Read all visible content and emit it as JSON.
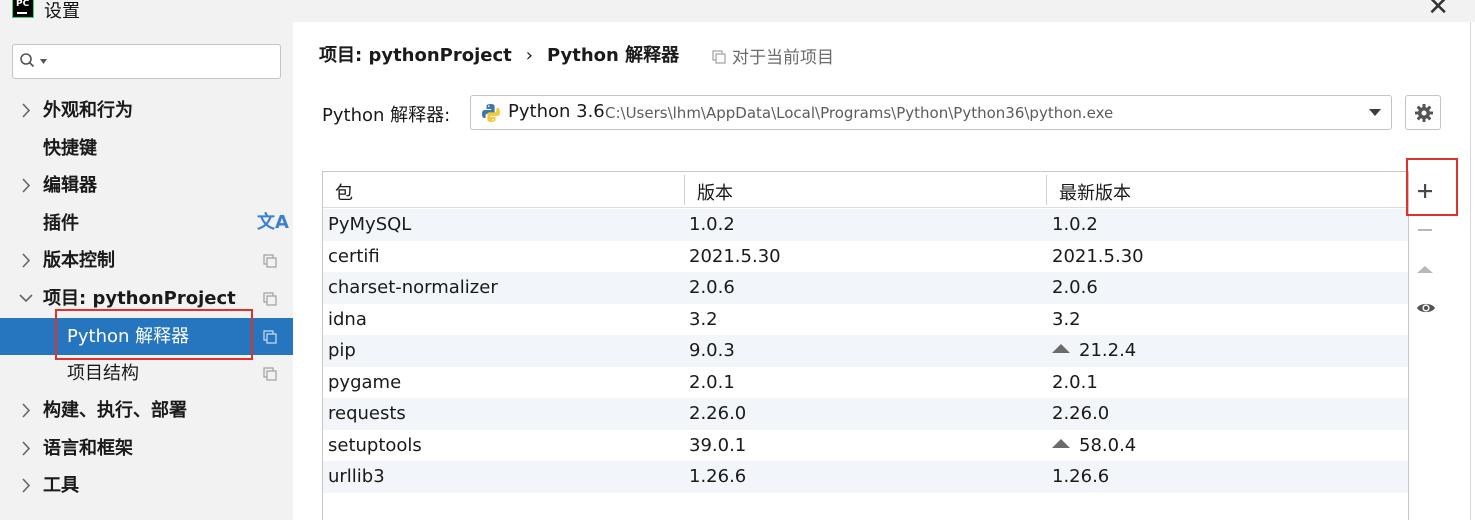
{
  "window": {
    "logo_text": "PC",
    "title": "设置"
  },
  "sidebar": {
    "search": {
      "value": "",
      "placeholder": ""
    },
    "items": [
      {
        "label": "外观和行为"
      },
      {
        "label": "快捷键"
      },
      {
        "label": "编辑器"
      },
      {
        "label": "插件"
      },
      {
        "label": "版本控制"
      },
      {
        "label": "项目: pythonProject"
      },
      {
        "label": "Python 解释器"
      },
      {
        "label": "项目结构"
      },
      {
        "label": "构建、执行、部署"
      },
      {
        "label": "语言和框架"
      },
      {
        "label": "工具"
      }
    ],
    "translate_glyph": "文A"
  },
  "breadcrumb": {
    "project": "项目: pythonProject",
    "separator": "›",
    "page": "Python 解释器",
    "scope_link": "对于当前项目"
  },
  "interpreter": {
    "label": "Python 解释器:",
    "name": "Python 3.6",
    "path": "C:\\Users\\lhm\\AppData\\Local\\Programs\\Python\\Python36\\python.exe"
  },
  "packages": {
    "columns": [
      "包",
      "版本",
      "最新版本"
    ],
    "rows": [
      {
        "name": "PyMySQL",
        "version": "1.0.2",
        "latest": "1.0.2",
        "upgrade": false
      },
      {
        "name": "certifi",
        "version": "2021.5.30",
        "latest": "2021.5.30",
        "upgrade": false
      },
      {
        "name": "charset-normalizer",
        "version": "2.0.6",
        "latest": "2.0.6",
        "upgrade": false
      },
      {
        "name": "idna",
        "version": "3.2",
        "latest": "3.2",
        "upgrade": false
      },
      {
        "name": "pip",
        "version": "9.0.3",
        "latest": "21.2.4",
        "upgrade": true
      },
      {
        "name": "pygame",
        "version": "2.0.1",
        "latest": "2.0.1",
        "upgrade": false
      },
      {
        "name": "requests",
        "version": "2.26.0",
        "latest": "2.26.0",
        "upgrade": false
      },
      {
        "name": "setuptools",
        "version": "39.0.1",
        "latest": "58.0.4",
        "upgrade": true
      },
      {
        "name": "urllib3",
        "version": "1.26.6",
        "latest": "1.26.6",
        "upgrade": false
      }
    ]
  },
  "toolbar": {
    "icons": [
      "plus-icon",
      "minus-icon",
      "upgrade-icon",
      "eye-icon"
    ]
  },
  "colors": {
    "selection": "#2675bf",
    "highlight_border": "#e0322d",
    "row_alt": "#f2f5f9"
  }
}
